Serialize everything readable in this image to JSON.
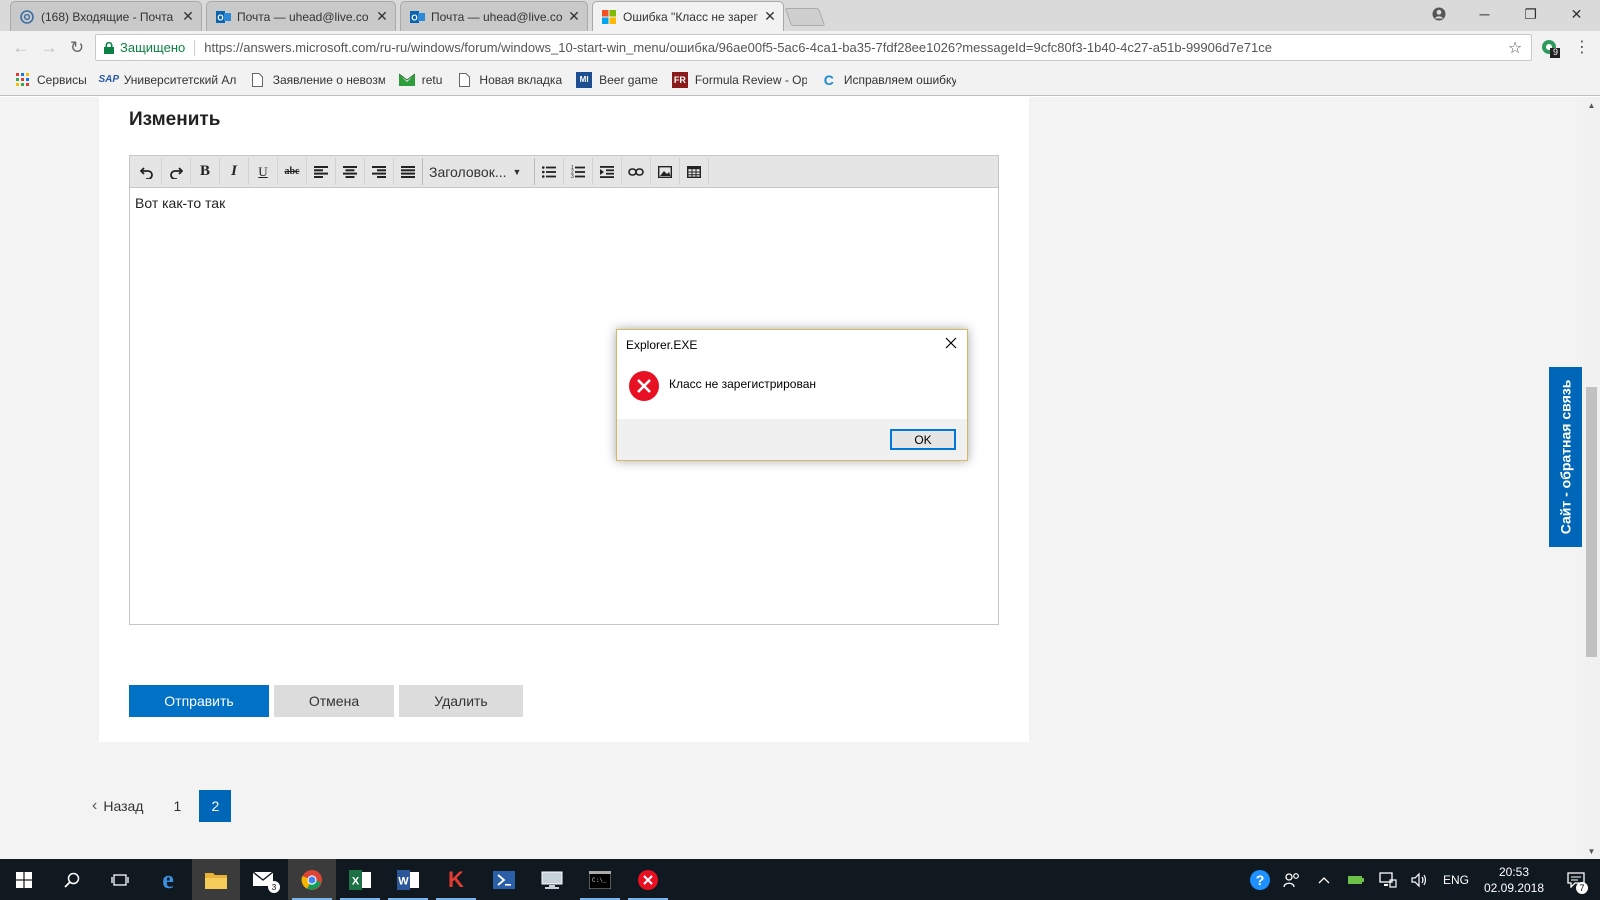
{
  "browser": {
    "tabs": [
      {
        "title": "(168) Входящие - Почта",
        "icon": "mail-at-icon",
        "active": false
      },
      {
        "title": "Почта — uhead@live.co",
        "icon": "outlook-icon",
        "active": false
      },
      {
        "title": "Почта — uhead@live.co",
        "icon": "outlook-icon",
        "active": false
      },
      {
        "title": "Ошибка \"Класс не зарег",
        "icon": "microsoft-logo-icon",
        "active": true
      }
    ],
    "secure_label": "Защищено",
    "url": "https://answers.microsoft.com/ru-ru/windows/forum/windows_10-start-win_menu/ошибка/96ae00f5-5ac6-4ca1-ba35-7fdf28ee1026?messageId=9cfc80f3-1b40-4c27-a51b-99906d7e71ce",
    "extension_badge": "9",
    "bookmarks": [
      {
        "label": "Сервисы",
        "icon": "apps-grid-icon"
      },
      {
        "label": "Университетский Ал",
        "icon": "university-icon"
      },
      {
        "label": "Заявление о невозм",
        "icon": "page-icon"
      },
      {
        "label": "retu",
        "icon": "envelope-green-icon"
      },
      {
        "label": "Новая вкладка",
        "icon": "page-icon"
      },
      {
        "label": "Beer game",
        "icon": "beer-game-icon"
      },
      {
        "label": "Formula Review - Op",
        "icon": "fr-icon"
      },
      {
        "label": "Исправляем ошибку",
        "icon": "c-icon"
      }
    ]
  },
  "page": {
    "heading": "Изменить",
    "editor": {
      "heading_select": "Заголовок...",
      "content": "Вот как-то так"
    },
    "buttons": {
      "send": "Отправить",
      "cancel": "Отмена",
      "delete": "Удалить"
    },
    "pager": {
      "back": "Назад",
      "pages": [
        "1",
        "2"
      ],
      "current": "2"
    },
    "feedback": "Сайт - обратная связь"
  },
  "dialog": {
    "title": "Explorer.EXE",
    "message": "Класс не зарегистрирован",
    "ok": "OK"
  },
  "taskbar": {
    "mail_badge": "3",
    "lang": "ENG",
    "time": "20:53",
    "date": "02.09.2018",
    "notifications": "7"
  },
  "colors": {
    "accent": "#0071c5",
    "pager_current": "#0067b8",
    "error": "#e81123"
  }
}
